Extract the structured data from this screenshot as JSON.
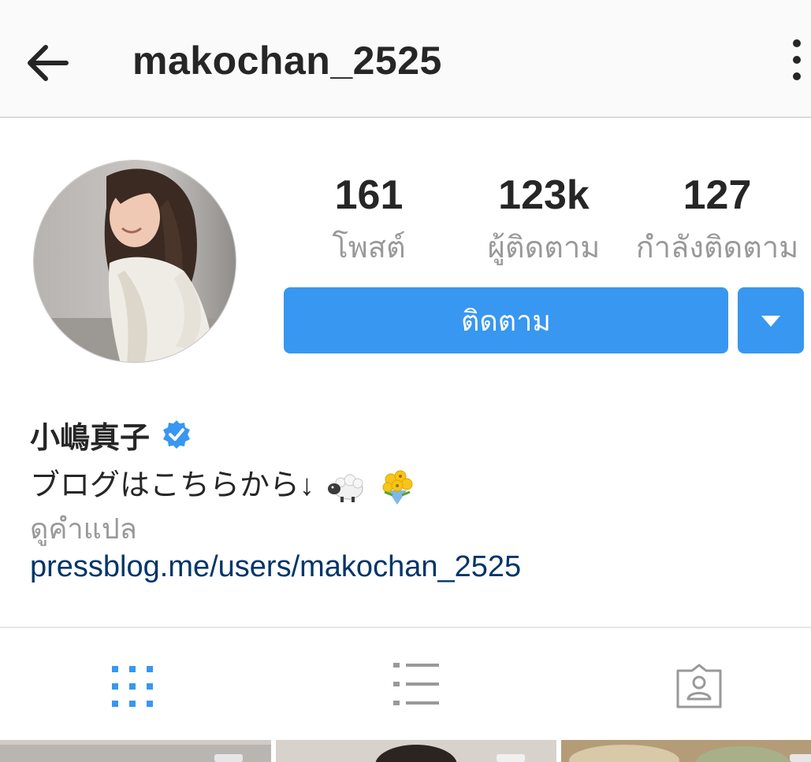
{
  "header": {
    "username": "makochan_2525",
    "back_icon": "arrow-left-icon",
    "more_icon": "more-vertical-icon"
  },
  "profile": {
    "avatar_icon": "profile-photo",
    "stats": {
      "posts": {
        "value": "161",
        "label": "โพสต์"
      },
      "followers": {
        "value": "123k",
        "label": "ผู้ติดตาม"
      },
      "following": {
        "value": "127",
        "label": "กำลังติดตาม"
      }
    },
    "follow_label": "ติดตาม",
    "dropdown_icon": "caret-down-icon",
    "name": "小嶋真子",
    "verified_icon": "verified-badge-icon",
    "bio_text": "ブログはこちらから↓",
    "bio_emojis": [
      "sheep-emoji",
      "bouquet-emoji"
    ],
    "translate_label": "ดูคำแปล",
    "link": "pressblog.me/users/makochan_2525"
  },
  "tabs": [
    {
      "name": "grid-view",
      "icon": "grid-icon",
      "active": true
    },
    {
      "name": "list-view",
      "icon": "list-icon",
      "active": false
    },
    {
      "name": "tagged-view",
      "icon": "tagged-person-icon",
      "active": false
    }
  ],
  "colors": {
    "accent": "#3897f0",
    "link": "#003569",
    "muted": "#999999",
    "text": "#262626"
  }
}
